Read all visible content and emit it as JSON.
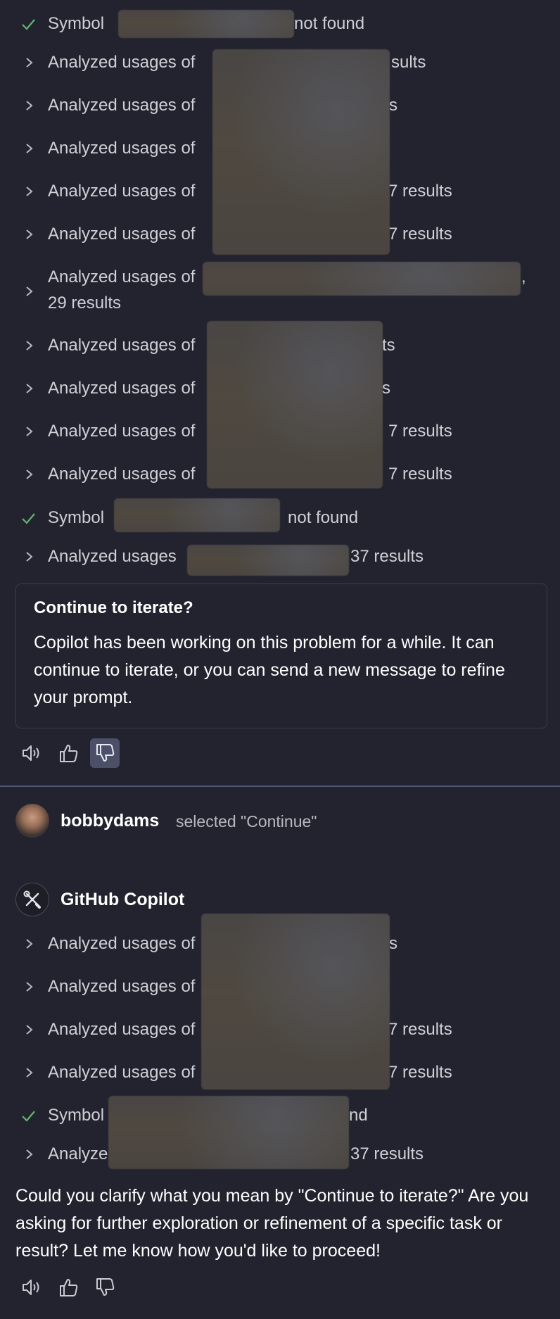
{
  "first_list": [
    {
      "icon": "check",
      "text": "Symbol",
      "tail": "not found"
    },
    {
      "icon": "chevron",
      "text": "Analyzed usages of",
      "tail": "sults"
    },
    {
      "icon": "chevron",
      "text": "Analyzed usages of",
      "tail": "s"
    },
    {
      "icon": "chevron",
      "text": "Analyzed usages of",
      "tail": ""
    },
    {
      "icon": "chevron",
      "text": "Analyzed usages of",
      "tail": "7 results"
    },
    {
      "icon": "chevron",
      "text": "Analyzed usages of",
      "tail": "7 results"
    },
    {
      "icon": "chevron",
      "text": "Analyzed usages of",
      "tail": ",",
      "line2": "29 results"
    },
    {
      "icon": "chevron",
      "text": "Analyzed usages of",
      "tail": "ts"
    },
    {
      "icon": "chevron",
      "text": "Analyzed usages of",
      "tail": "s"
    },
    {
      "icon": "chevron",
      "text": "Analyzed usages of",
      "tail": "7 results"
    },
    {
      "icon": "chevron",
      "text": "Analyzed usages of",
      "tail": "7 results"
    },
    {
      "icon": "check",
      "text": "Symbol",
      "tail": "not found"
    },
    {
      "icon": "chevron",
      "text": "Analyzed usages",
      "tail": "37 results"
    }
  ],
  "prompt_box": {
    "title": "Continue to iterate?",
    "body": "Copilot has been working on this problem for a while. It can continue to iterate, or you can send a new message to refine your prompt."
  },
  "feedback": {
    "read_aloud": "speaker-icon",
    "thumbs_up": "thumbs-up-icon",
    "thumbs_down": "thumbs-down-icon",
    "active_color": "#4b4f68"
  },
  "user_message": {
    "username": "bobbydams",
    "action": "selected \"Continue\""
  },
  "assistant": {
    "name": "GitHub Copilot"
  },
  "second_list": [
    {
      "icon": "chevron",
      "text": "Analyzed usages of",
      "tail": "s"
    },
    {
      "icon": "chevron",
      "text": "Analyzed usages of",
      "tail": ""
    },
    {
      "icon": "chevron",
      "text": "Analyzed usages of",
      "tail": "7 results"
    },
    {
      "icon": "chevron",
      "text": "Analyzed usages of",
      "tail": "7 results"
    },
    {
      "icon": "check",
      "text": "Symbol",
      "tail": "nd"
    },
    {
      "icon": "chevron",
      "text": "Analyze",
      "tail": "37 results"
    }
  ],
  "answer": "Could you clarify what you mean by \"Continue to iterate?\" Are you asking for further exploration or refinement of a specific task or result? Let me know how you'd like to proceed!",
  "colors": {
    "background": "#23232f",
    "check": "#5fb86f",
    "divider": "#4f5572"
  }
}
